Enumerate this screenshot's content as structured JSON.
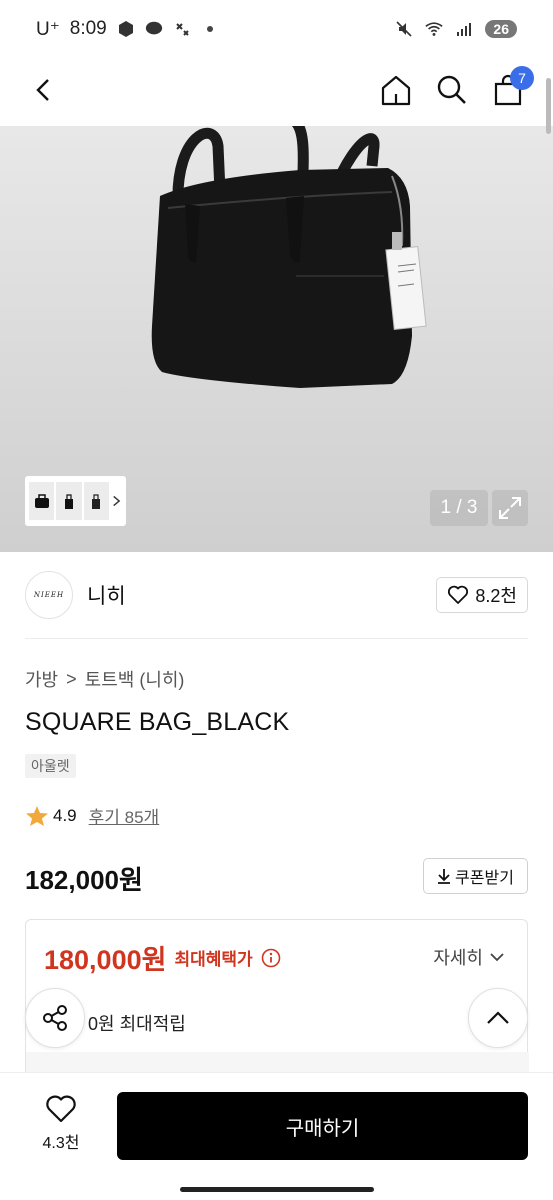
{
  "status_bar": {
    "carrier": "U⁺",
    "time": "8:09",
    "battery": "26"
  },
  "nav": {
    "cart_count": "7"
  },
  "gallery": {
    "counter": "1 / 3"
  },
  "brand": {
    "logo_text": "NIEEH",
    "name": "니히",
    "likes": "8.2천"
  },
  "breadcrumb": {
    "category": "가방",
    "separator": ">",
    "subcategory": "토트백 (니히)"
  },
  "product": {
    "title": "SQUARE BAG_BLACK",
    "tag": "아울렛",
    "rating": "4.9",
    "reviews": "후기 85개",
    "price": "182,000원",
    "coupon_label": "쿠폰받기"
  },
  "benefit": {
    "best_price": "180,000원",
    "best_price_label": "최대혜택가",
    "detail_label": "자세히",
    "points": "0원 최대적립"
  },
  "bottom": {
    "wish_count": "4.3천",
    "buy_label": "구매하기"
  },
  "colors": {
    "accent_red": "#d0361f",
    "badge_blue": "#3a6de8",
    "star": "#f2a93b"
  }
}
